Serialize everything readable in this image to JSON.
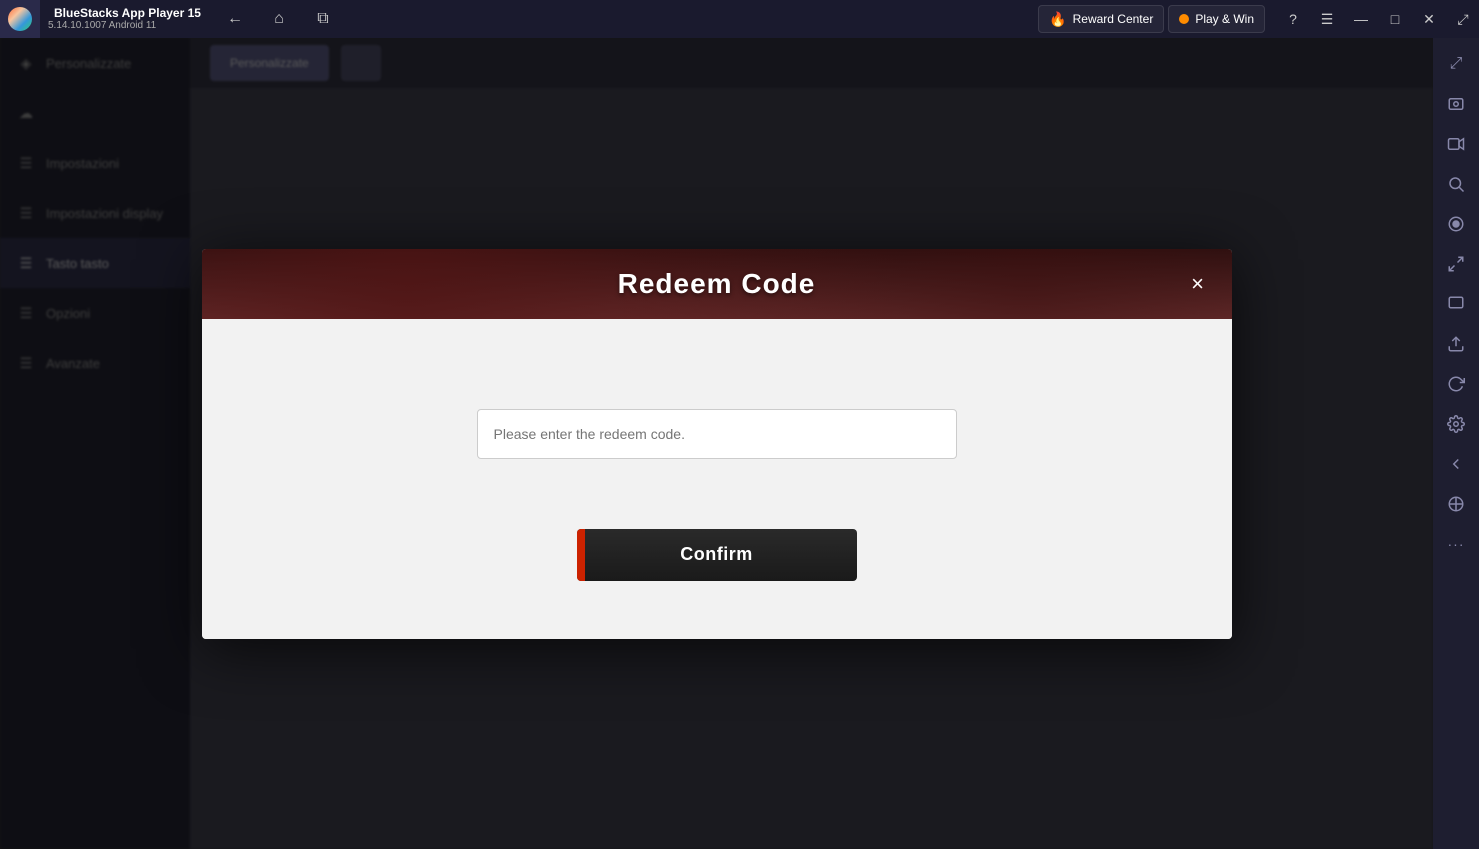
{
  "titlebar": {
    "app_name": "BlueStacks App Player 15",
    "app_version": "5.14.10.1007  Android 11",
    "logo_alt": "bluestacks-logo",
    "nav": {
      "back_label": "←",
      "home_label": "⌂",
      "tabs_label": "⧉"
    },
    "reward_center": "Reward Center",
    "play_win": "Play & Win",
    "help_label": "?",
    "menu_label": "☰",
    "minimize_label": "—",
    "maximize_label": "□",
    "close_label": "✕",
    "expand_label": "⤢"
  },
  "right_sidebar": {
    "icons": [
      {
        "name": "expand-icon",
        "symbol": "⤢"
      },
      {
        "name": "screenshot-icon",
        "symbol": "📷"
      },
      {
        "name": "camera-icon",
        "symbol": "🎥"
      },
      {
        "name": "refresh-icon",
        "symbol": "↻"
      },
      {
        "name": "record-icon",
        "symbol": "⏺"
      },
      {
        "name": "fullscreen-icon",
        "symbol": "⛶"
      },
      {
        "name": "zoom-icon",
        "symbol": "🔍"
      },
      {
        "name": "upload-icon",
        "symbol": "⬆"
      },
      {
        "name": "rotate-icon",
        "symbol": "↺"
      },
      {
        "name": "settings-icon",
        "symbol": "⚙"
      },
      {
        "name": "arrow-left-icon",
        "symbol": "←"
      },
      {
        "name": "location-icon",
        "symbol": "⊕"
      },
      {
        "name": "more-icon",
        "symbol": "···"
      }
    ]
  },
  "background": {
    "sidebar_items": [
      {
        "label": "Personalizzate",
        "icon": "◈",
        "active": false
      },
      {
        "label": "",
        "icon": "☁",
        "active": false
      },
      {
        "label": "Impostazioni",
        "icon": "☰",
        "active": false
      },
      {
        "label": "Impostazioni display",
        "icon": "☰",
        "active": false
      },
      {
        "label": "Tasto tasto",
        "icon": "☰",
        "active": true
      },
      {
        "label": "Opzioni",
        "icon": "☰",
        "active": false
      },
      {
        "label": "Avanzate",
        "icon": "☰",
        "active": false
      }
    ],
    "content_tabs": [
      {
        "label": "Personalizzate",
        "active": true
      },
      {
        "label": "",
        "active": false
      }
    ]
  },
  "modal": {
    "title": "Redeem Code",
    "close_label": "×",
    "description": "",
    "input_placeholder": "Please enter the redeem code.",
    "input_value": "",
    "confirm_label": "Confirm"
  }
}
